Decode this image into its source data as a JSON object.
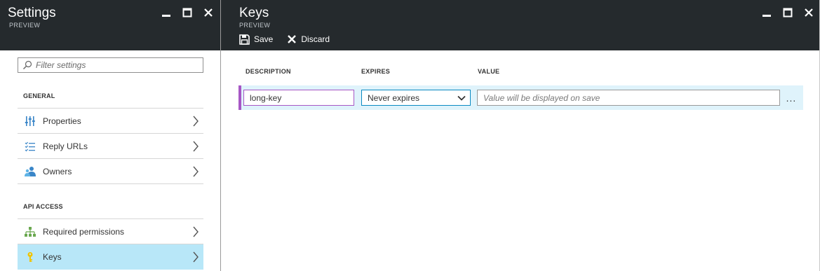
{
  "settings_blade": {
    "title": "Settings",
    "subtitle": "PREVIEW",
    "filter_placeholder": "Filter settings",
    "sections": [
      {
        "label": "GENERAL",
        "items": [
          {
            "label": "Properties",
            "icon": "properties-icon"
          },
          {
            "label": "Reply URLs",
            "icon": "list-icon"
          },
          {
            "label": "Owners",
            "icon": "owners-icon"
          }
        ]
      },
      {
        "label": "API ACCESS",
        "items": [
          {
            "label": "Required permissions",
            "icon": "permissions-icon"
          },
          {
            "label": "Keys",
            "icon": "key-icon",
            "selected": true
          }
        ]
      }
    ]
  },
  "keys_blade": {
    "title": "Keys",
    "subtitle": "PREVIEW",
    "toolbar": {
      "save_label": "Save",
      "discard_label": "Discard"
    },
    "columns": {
      "description": "DESCRIPTION",
      "expires": "EXPIRES",
      "value": "VALUE"
    },
    "row": {
      "description_value": "long-key",
      "expires_value": "Never expires",
      "value_placeholder": "Value will be displayed on save",
      "more_label": "..."
    }
  },
  "colors": {
    "header_bg": "#252a2d",
    "selected_bg": "#b8e7f8",
    "row_bg": "#dff3fb",
    "accent_purple": "#a757c5",
    "accent_blue": "#0a8ac2"
  }
}
